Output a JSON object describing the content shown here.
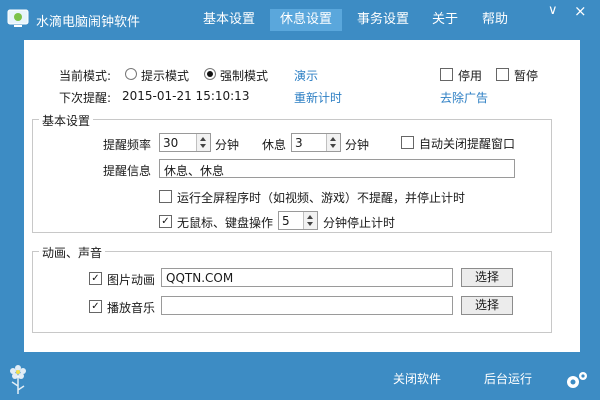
{
  "titlebar": {
    "app_title": "水滴电脑闹钟软件",
    "tabs": [
      "基本设置",
      "休息设置",
      "事务设置",
      "关于",
      "帮助"
    ],
    "active_tab": "休息设置",
    "menu_symbol": "∨",
    "close_symbol": "×"
  },
  "mode": {
    "label": "当前模式:",
    "option_prompt": "提示模式",
    "option_force": "强制模式",
    "selected": "强制模式",
    "demo_link": "演示",
    "disable_label": "停用",
    "pause_label": "暂停"
  },
  "next": {
    "label": "下次提醒:",
    "time": "2015-01-21 15:10:13",
    "restart_link": "重新计时",
    "remove_ads_link": "去除广告"
  },
  "basic": {
    "title": "基本设置",
    "freq_label": "提醒频率",
    "freq_value": "30",
    "freq_unit": "分钟",
    "rest_label": "休息",
    "rest_value": "3",
    "rest_unit": "分钟",
    "auto_close_label": "自动关闭提醒窗口",
    "auto_close_checked": false,
    "message_label": "提醒信息",
    "message_value": "休息、休息",
    "fullscreen_label": "运行全屏程序时（如视频、游戏）不提醒，并停止计时",
    "fullscreen_checked": false,
    "idle_label_pre": "无鼠标、键盘操作",
    "idle_value": "5",
    "idle_label_post": "分钟停止计时",
    "idle_checked": true
  },
  "media": {
    "title": "动画、声音",
    "anim_label": "图片动画",
    "anim_checked": true,
    "anim_value": "QQTN.COM",
    "music_label": "播放音乐",
    "music_checked": true,
    "music_value": "",
    "select_label": "选择"
  },
  "footer": {
    "close_label": "关闭软件",
    "background_label": "后台运行"
  },
  "check_mark": "✓"
}
